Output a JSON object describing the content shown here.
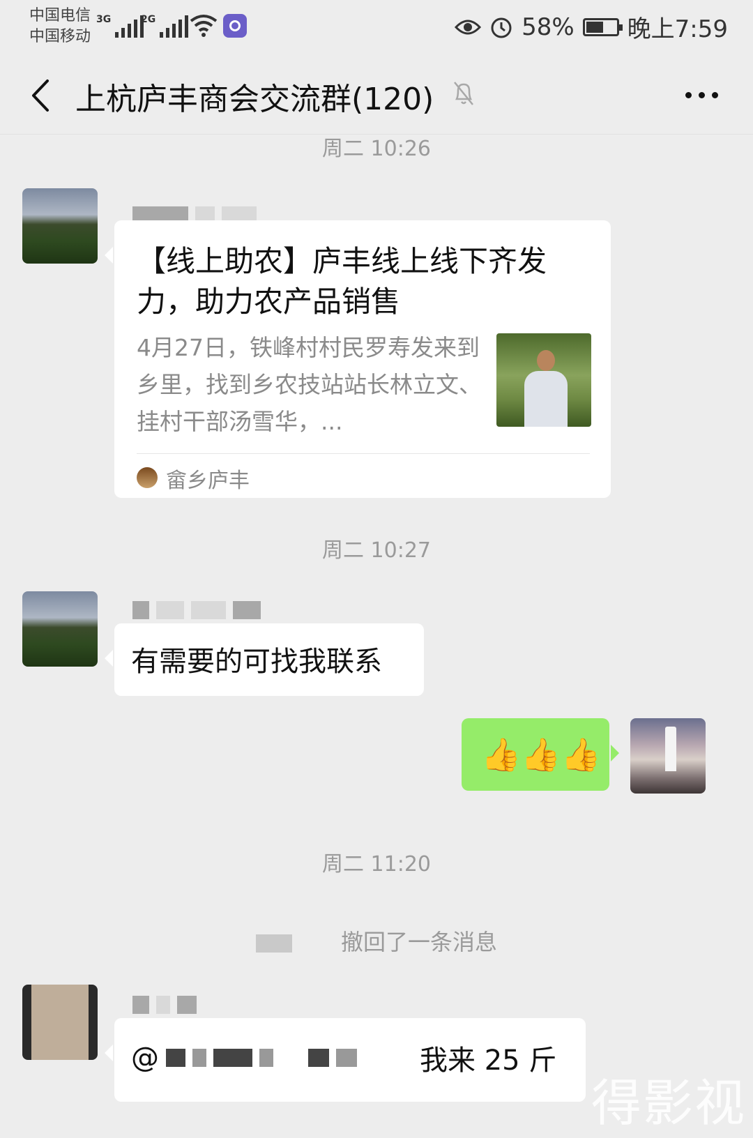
{
  "status_bar": {
    "carrier1": "中国电信",
    "carrier2": "中国移动",
    "net1": "3G",
    "net2": "2G",
    "battery_percent": "58%",
    "battery_level": 0.58,
    "time": "晚上7:59"
  },
  "header": {
    "title": "上杭庐丰商会交流群(120)",
    "icons": [
      "back-icon",
      "muted-bell-icon",
      "more-icon"
    ]
  },
  "chat": {
    "timestamps": [
      "周二 10:26",
      "周二 10:27",
      "周二 11:20"
    ],
    "card": {
      "title": "【线上助农】庐丰线上线下齐发力，助力农产品销售",
      "desc": "4月27日，铁峰村村民罗寿发来到乡里，找到乡农技站站长林立文、挂村干部汤雪华，...",
      "source": "畲乡庐丰"
    },
    "msg_text": "有需要的可找我联系",
    "my_reply": "👍👍👍",
    "recall_text": "撤回了一条消息",
    "last_prefix": "@",
    "last_tail": "我来 25 斤",
    "watermark": "得影视"
  }
}
